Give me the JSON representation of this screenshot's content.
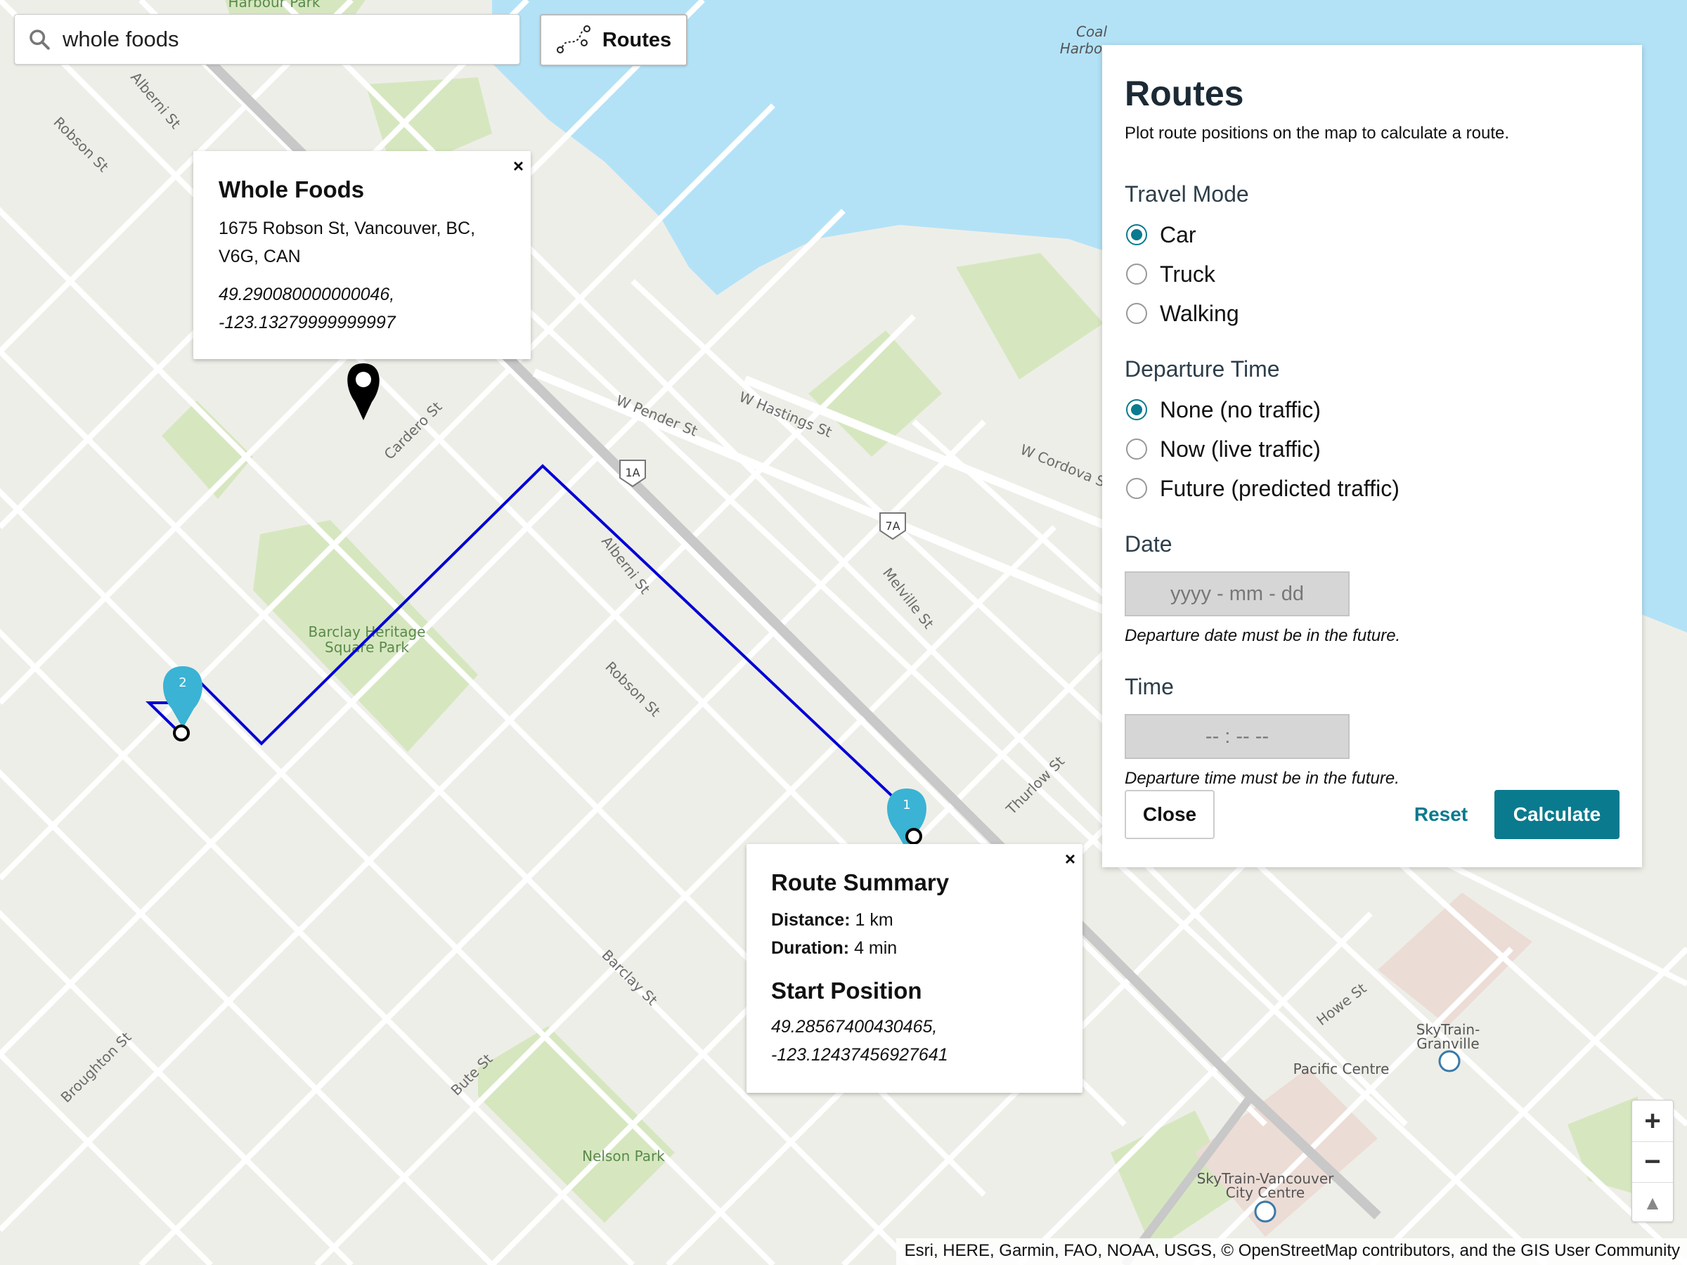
{
  "search": {
    "value": "whole foods",
    "icon": "search-icon"
  },
  "toolbar": {
    "routes_label": "Routes",
    "routes_icon": "route-icon"
  },
  "map": {
    "streets": [
      "Alberni St",
      "Robson St",
      "Cardero St",
      "W Pender St",
      "W Hastings St",
      "W Cordova St",
      "Melville St",
      "Thurlow St",
      "Barclay St",
      "Bute St",
      "Broughton St",
      "Howe St"
    ],
    "shields": [
      "1A",
      "7A"
    ],
    "parks": [
      "Barclay Heritage Square Park",
      "Nelson Park",
      "Harbour Park"
    ],
    "places": [
      "Pacific Centre",
      "SkyTrain-Granville",
      "SkyTrain-Vancouver City Centre",
      "Coal Harbour"
    ],
    "marker_1": "1",
    "marker_2": "2",
    "route_color": "#0000d6",
    "water_color": "#b3e2f7"
  },
  "popup_place": {
    "title": "Whole Foods",
    "address": "1675 Robson St, Vancouver, BC, V6G, CAN",
    "coord_lat": "49.290080000000046,",
    "coord_lon": "-123.13279999999997",
    "close": "×"
  },
  "popup_route": {
    "title": "Route Summary",
    "distance_label": "Distance:",
    "distance_value": "1 km",
    "duration_label": "Duration:",
    "duration_value": "4 min",
    "start_title": "Start Position",
    "coord_lat": "49.28567400430465,",
    "coord_lon": "-123.12437456927641",
    "close": "×"
  },
  "panel": {
    "title": "Routes",
    "subtitle": "Plot route positions on the map to calculate a route.",
    "travel_mode_label": "Travel Mode",
    "travel_modes": [
      "Car",
      "Truck",
      "Walking"
    ],
    "travel_mode_selected": "Car",
    "departure_label": "Departure Time",
    "departure_options": [
      "None (no traffic)",
      "Now (live traffic)",
      "Future (predicted traffic)"
    ],
    "departure_selected": "None (no traffic)",
    "date_label": "Date",
    "date_placeholder": "yyyy - mm - dd",
    "date_hint": "Departure date must be in the future.",
    "time_label": "Time",
    "time_placeholder": "-- : --   --",
    "time_hint": "Departure time must be in the future.",
    "close_label": "Close",
    "reset_label": "Reset",
    "calculate_label": "Calculate",
    "accent_color": "#0a7a8e"
  },
  "zoom": {
    "in": "+",
    "out": "−",
    "compass": "▲"
  },
  "attribution": "Esri, HERE, Garmin, FAO, NOAA, USGS, © OpenStreetMap contributors, and the GIS User Community"
}
